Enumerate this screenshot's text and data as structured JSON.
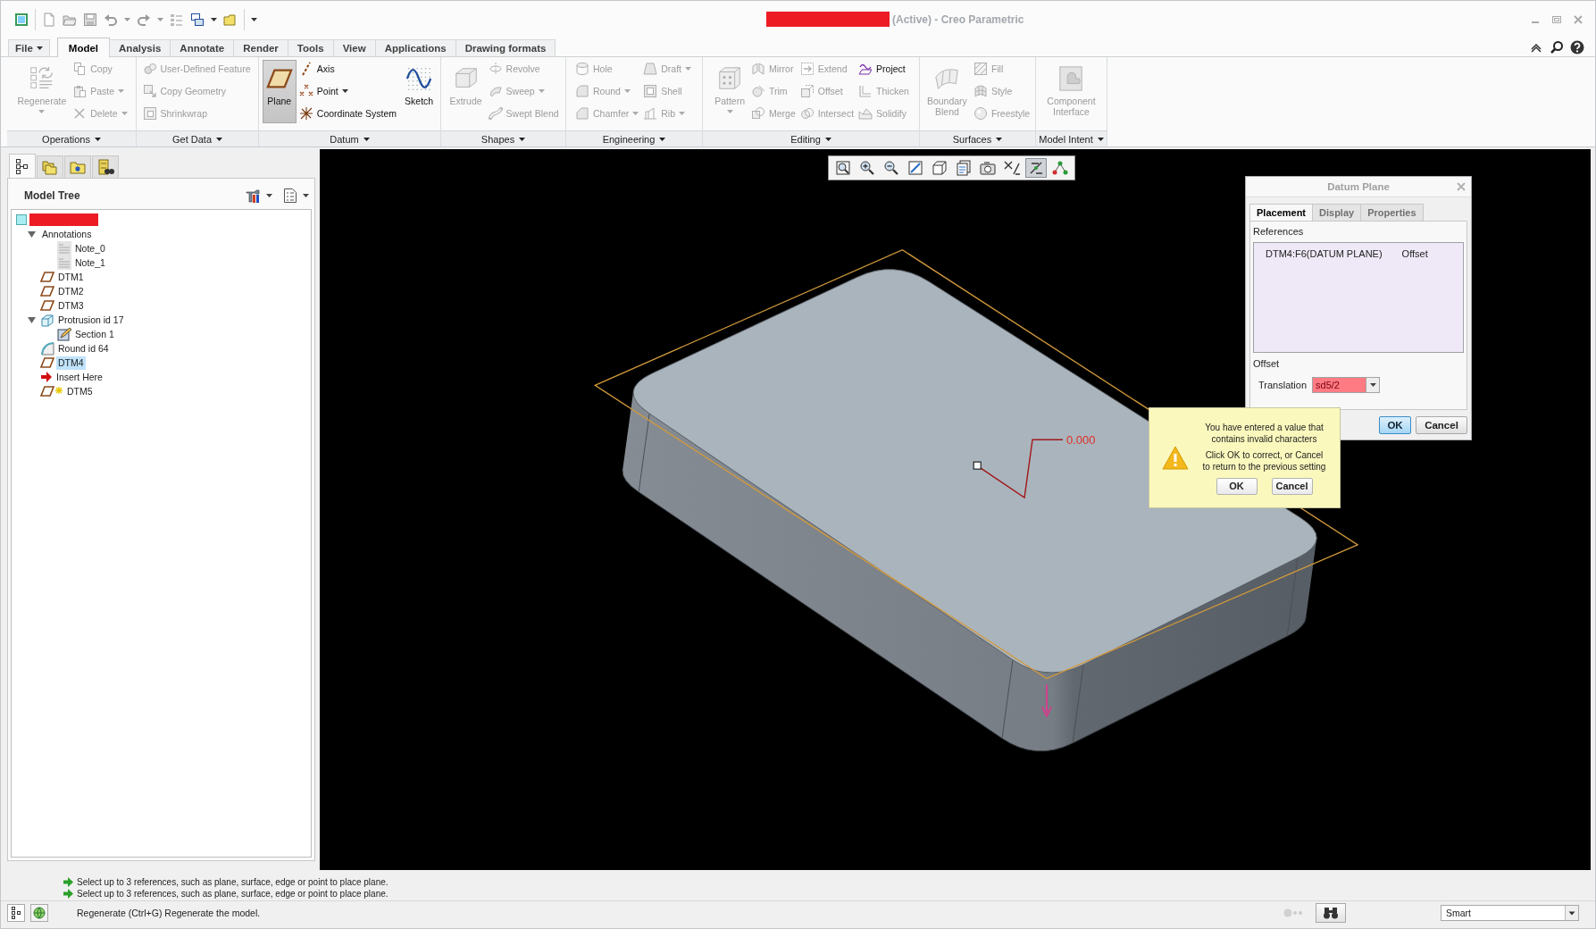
{
  "window": {
    "redacted": true,
    "title": "(Active) - Creo Parametric"
  },
  "ribbon_tabs": [
    {
      "label": "File",
      "kind": "menu",
      "selected": false
    },
    {
      "label": "Model",
      "kind": "tab",
      "selected": true
    },
    {
      "label": "Analysis",
      "kind": "tab",
      "selected": false
    },
    {
      "label": "Annotate",
      "kind": "tab",
      "selected": false
    },
    {
      "label": "Render",
      "kind": "tab",
      "selected": false
    },
    {
      "label": "Tools",
      "kind": "tab",
      "selected": false
    },
    {
      "label": "View",
      "kind": "tab",
      "selected": false
    },
    {
      "label": "Applications",
      "kind": "tab",
      "selected": false
    },
    {
      "label": "Drawing formats",
      "kind": "tab",
      "selected": false
    }
  ],
  "ribbon_groups": [
    {
      "label": "Operations",
      "columns": [
        {
          "kind": "large",
          "items": [
            {
              "label": "Regenerate",
              "disabled": true,
              "dropdown": true
            }
          ]
        },
        {
          "kind": "small",
          "items": [
            {
              "label": "Copy",
              "disabled": true
            },
            {
              "label": "Paste",
              "disabled": true,
              "dropdown": true
            },
            {
              "label": "Delete",
              "disabled": true,
              "dropdown": true
            }
          ]
        }
      ]
    },
    {
      "label": "Get Data",
      "columns": [
        {
          "kind": "small",
          "items": [
            {
              "label": "User-Defined Feature",
              "disabled": true
            },
            {
              "label": "Copy Geometry",
              "disabled": true
            },
            {
              "label": "Shrinkwrap",
              "disabled": true
            }
          ]
        }
      ]
    },
    {
      "label": "Datum",
      "columns": [
        {
          "kind": "large",
          "items": [
            {
              "label": "Plane",
              "disabled": false,
              "pressed": true
            }
          ]
        },
        {
          "kind": "small",
          "items": [
            {
              "label": "Axis",
              "disabled": false
            },
            {
              "label": "Point",
              "disabled": false,
              "dropdown": true
            },
            {
              "label": "Coordinate System",
              "disabled": false
            }
          ]
        },
        {
          "kind": "large",
          "items": [
            {
              "label": "Sketch",
              "disabled": false
            }
          ]
        }
      ]
    },
    {
      "label": "Shapes",
      "columns": [
        {
          "kind": "large",
          "items": [
            {
              "label": "Extrude",
              "disabled": true
            }
          ]
        },
        {
          "kind": "small",
          "items": [
            {
              "label": "Revolve",
              "disabled": true
            },
            {
              "label": "Sweep",
              "disabled": true,
              "dropdown": true
            },
            {
              "label": "Swept Blend",
              "disabled": true
            }
          ]
        }
      ]
    },
    {
      "label": "Engineering",
      "columns": [
        {
          "kind": "small",
          "items": [
            {
              "label": "Hole",
              "disabled": true
            },
            {
              "label": "Round",
              "disabled": true,
              "dropdown": true
            },
            {
              "label": "Chamfer",
              "disabled": true,
              "dropdown": true
            }
          ]
        },
        {
          "kind": "small",
          "items": [
            {
              "label": "Draft",
              "disabled": true,
              "dropdown": true
            },
            {
              "label": "Shell",
              "disabled": true
            },
            {
              "label": "Rib",
              "disabled": true,
              "dropdown": true
            }
          ]
        }
      ]
    },
    {
      "label": "Editing",
      "columns": [
        {
          "kind": "large",
          "items": [
            {
              "label": "Pattern",
              "disabled": true,
              "dropdown": true
            }
          ]
        },
        {
          "kind": "small",
          "items": [
            {
              "label": "Mirror",
              "disabled": true
            },
            {
              "label": "Trim",
              "disabled": true
            },
            {
              "label": "Merge",
              "disabled": true
            }
          ]
        },
        {
          "kind": "small",
          "items": [
            {
              "label": "Extend",
              "disabled": true
            },
            {
              "label": "Offset",
              "disabled": true
            },
            {
              "label": "Intersect",
              "disabled": true
            }
          ]
        },
        {
          "kind": "small",
          "items": [
            {
              "label": "Project",
              "disabled": false
            },
            {
              "label": "Thicken",
              "disabled": true
            },
            {
              "label": "Solidify",
              "disabled": true
            }
          ]
        }
      ]
    },
    {
      "label": "Surfaces",
      "columns": [
        {
          "kind": "large",
          "items": [
            {
              "label": "Boundary Blend",
              "disabled": true
            }
          ]
        },
        {
          "kind": "small",
          "items": [
            {
              "label": "Fill",
              "disabled": true
            },
            {
              "label": "Style",
              "disabled": true
            },
            {
              "label": "Freestyle",
              "disabled": true
            }
          ]
        }
      ]
    },
    {
      "label": "Model Intent",
      "columns": [
        {
          "kind": "large",
          "items": [
            {
              "label": "Component Interface",
              "disabled": true
            }
          ]
        }
      ]
    }
  ],
  "model_tree": {
    "title": "Model Tree",
    "tabs": [
      {
        "selected": true
      },
      {
        "selected": false
      },
      {
        "selected": false
      },
      {
        "selected": false
      }
    ],
    "root": {
      "kind": "part",
      "redacted": true,
      "children": [
        {
          "label": "Annotations",
          "kind": "group",
          "expanded": true,
          "selected": false,
          "children": [
            {
              "label": "Note_0",
              "kind": "note",
              "selected": false
            },
            {
              "label": "Note_1",
              "kind": "note",
              "selected": false
            }
          ]
        },
        {
          "label": "DTM1",
          "kind": "datum-plane",
          "selected": false
        },
        {
          "label": "DTM2",
          "kind": "datum-plane",
          "selected": false
        },
        {
          "label": "DTM3",
          "kind": "datum-plane",
          "selected": false
        },
        {
          "label": "Protrusion id 17",
          "kind": "protrusion",
          "expanded": true,
          "selected": false,
          "children": [
            {
              "label": "Section 1",
              "kind": "sketch",
              "selected": false
            }
          ]
        },
        {
          "label": "Round id 64",
          "kind": "round",
          "selected": false
        },
        {
          "label": "DTM4",
          "kind": "datum-plane",
          "selected": true
        },
        {
          "label": "Insert Here",
          "kind": "insert-marker",
          "selected": false
        },
        {
          "label": "DTM5",
          "kind": "new-datum-plane",
          "selected": false
        }
      ]
    }
  },
  "viewport": {
    "toolbar": [
      {
        "pressed": false
      },
      {
        "pressed": false
      },
      {
        "pressed": false
      },
      {
        "pressed": false
      },
      {
        "pressed": false
      },
      {
        "pressed": false
      },
      {
        "pressed": false
      },
      {
        "pressed": false
      },
      {
        "pressed": true
      },
      {
        "pressed": false
      }
    ],
    "dimension": "0.000"
  },
  "datum_plane_dialog": {
    "title": "Datum Plane",
    "tabs": [
      {
        "label": "Placement",
        "selected": true
      },
      {
        "label": "Display",
        "selected": false
      },
      {
        "label": "Properties",
        "selected": false
      }
    ],
    "references_label": "References",
    "references": [
      {
        "name": "DTM4:F6(DATUM PLANE)",
        "constraint": "Offset"
      }
    ],
    "offset_label": "Offset",
    "translation": {
      "label": "Translation",
      "value": "sd5/2",
      "invalid": true
    },
    "buttons": [
      {
        "label": "OK",
        "default": true
      },
      {
        "label": "Cancel",
        "default": false
      }
    ]
  },
  "error_balloon": {
    "message": "You have entered a value that contains invalid characters",
    "instruction": "Click OK to correct, or Cancel to return to the previous setting",
    "buttons": [
      {
        "label": "OK"
      },
      {
        "label": "Cancel"
      }
    ]
  },
  "status_bar": {
    "messages": [
      "Select up to 3 references, such as plane, surface, edge or point to place plane.",
      "Select up to 3 references, such as plane, surface, edge or point to place plane."
    ],
    "hint": "Regenerate (Ctrl+G) Regenerate the model.",
    "selection_filter": "Smart"
  }
}
